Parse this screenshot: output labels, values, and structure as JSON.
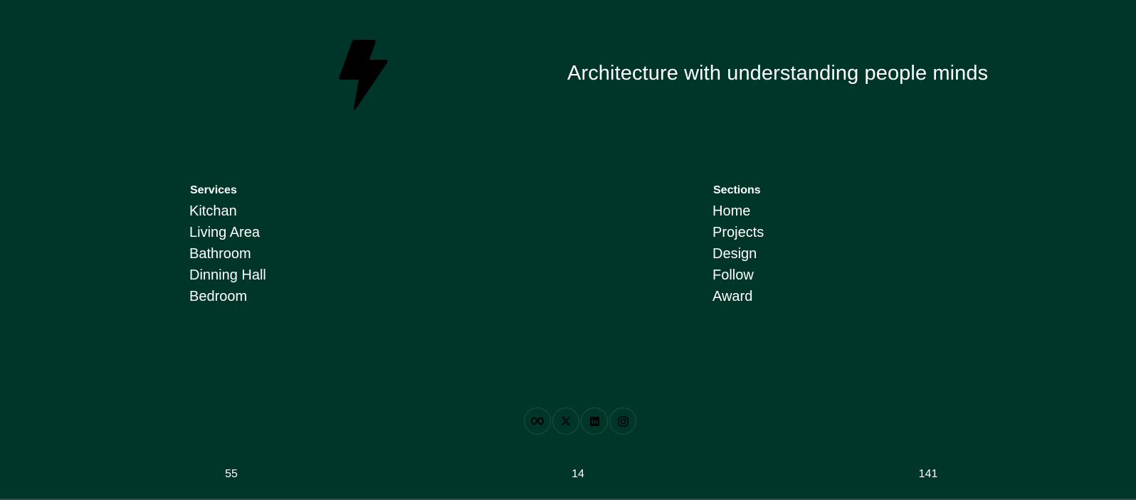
{
  "header": {
    "logo_icon": "lightning-bolt-icon",
    "tagline": "Architecture with understanding people minds"
  },
  "services": {
    "heading": "Services",
    "items": [
      "Kitchan",
      "Living Area",
      "Bathroom",
      "Dinning Hall",
      "Bedroom"
    ]
  },
  "sections": {
    "heading": "Sections",
    "items": [
      "Home",
      "Projects",
      "Design",
      "Follow",
      "Award"
    ]
  },
  "social": {
    "icons": [
      "meta-icon",
      "x-icon",
      "linkedin-icon",
      "instagram-icon"
    ]
  },
  "stats": [
    "55",
    "14",
    "141"
  ],
  "colors": {
    "background": "#00352a",
    "text": "#ffffff",
    "icon": "#000000"
  }
}
